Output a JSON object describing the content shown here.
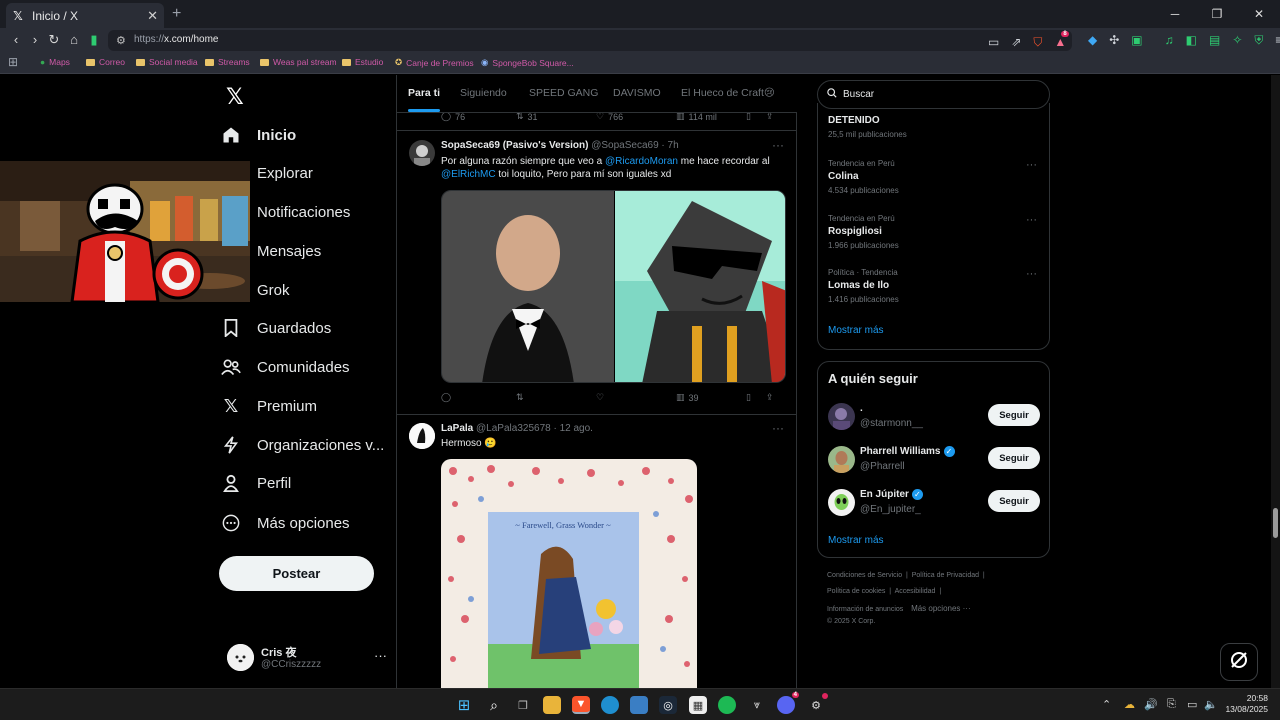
{
  "browser": {
    "tab_title": "Inicio / X",
    "url_prefix": "https://",
    "url_host": "x.com/home",
    "bookmarks": [
      "Maps",
      "Correo",
      "Social media",
      "Streams",
      "Weas pal stream",
      "Estudio",
      "Canje de Premios",
      "SpongeBob Square..."
    ],
    "shield_badge": "8"
  },
  "nav": {
    "items": [
      {
        "label": "Inicio",
        "icon": "home-icon"
      },
      {
        "label": "Explorar",
        "icon": "search-icon"
      },
      {
        "label": "Notificaciones",
        "icon": "bell-icon"
      },
      {
        "label": "Mensajes",
        "icon": "mail-icon"
      },
      {
        "label": "Grok",
        "icon": "grok-icon"
      },
      {
        "label": "Guardados",
        "icon": "bookmark-icon"
      },
      {
        "label": "Comunidades",
        "icon": "communities-icon"
      },
      {
        "label": "Premium",
        "icon": "x-icon"
      },
      {
        "label": "Organizaciones v...",
        "icon": "lightning-icon"
      },
      {
        "label": "Perfil",
        "icon": "person-icon"
      },
      {
        "label": "Más opciones",
        "icon": "more-circle-icon"
      }
    ],
    "post_button": "Postear",
    "user": {
      "name": "Cris 夜",
      "handle": "@CCriszzzzz"
    }
  },
  "feed": {
    "tabs": [
      "Para ti",
      "Siguiendo",
      "SPEED GANG",
      "DAVISMO",
      "El Hueco de Craft😢"
    ],
    "prev_actions": {
      "replies": "76",
      "reposts": "31",
      "likes": "766",
      "views": "114 mil"
    },
    "post1": {
      "name": "SopaSeca69 (Pasivo's Version)",
      "handle": "@SopaSeca69 · 7h",
      "text_1": "Por alguna razón siempre que veo a ",
      "mention_1": "@RicardoMoran",
      "text_2": " me hace recordar al ",
      "mention_2": "@ElRichMC",
      "text_3": " toi loquito, Pero para mí son iguales xd",
      "views": "39"
    },
    "post2": {
      "name": "LaPala",
      "handle": "@LaPala325678 · 12 ago.",
      "text": "Hermoso 🥲",
      "image_caption": "~ Farewell, Grass Wonder ~"
    }
  },
  "right": {
    "search_placeholder": "Buscar",
    "trends": [
      {
        "meta": "",
        "title": "DETENIDO",
        "count": "25,5 mil publicaciones"
      },
      {
        "meta": "Tendencia en Perú",
        "title": "Colina",
        "count": "4.534 publicaciones"
      },
      {
        "meta": "Tendencia en Perú",
        "title": "Rospigliosi",
        "count": "1.966 publicaciones"
      },
      {
        "meta": "Política · Tendencia",
        "title": "Lomas de Ilo",
        "count": "1.416 publicaciones"
      }
    ],
    "show_more": "Mostrar más",
    "who_to_follow": {
      "title": "A quién seguir",
      "accounts": [
        {
          "name": ".",
          "handle": "@starmonn__",
          "verified": false
        },
        {
          "name": "Pharrell Williams",
          "handle": "@Pharrell",
          "verified": true
        },
        {
          "name": "En Júpiter",
          "handle": "@En_jupiter_",
          "verified": true
        }
      ],
      "follow_label": "Seguir",
      "show_more": "Mostrar más"
    },
    "footer": {
      "line1": [
        "Condiciones de Servicio",
        "Política de Privacidad"
      ],
      "line2": [
        "Política de cookies",
        "Accesibilidad"
      ],
      "line3": [
        "Información de anuncios",
        "Más opciones ···"
      ],
      "copyright": "© 2025 X Corp."
    }
  },
  "taskbar": {
    "time": "20:58",
    "date": "13/08/2025",
    "discord_badge": "4"
  }
}
